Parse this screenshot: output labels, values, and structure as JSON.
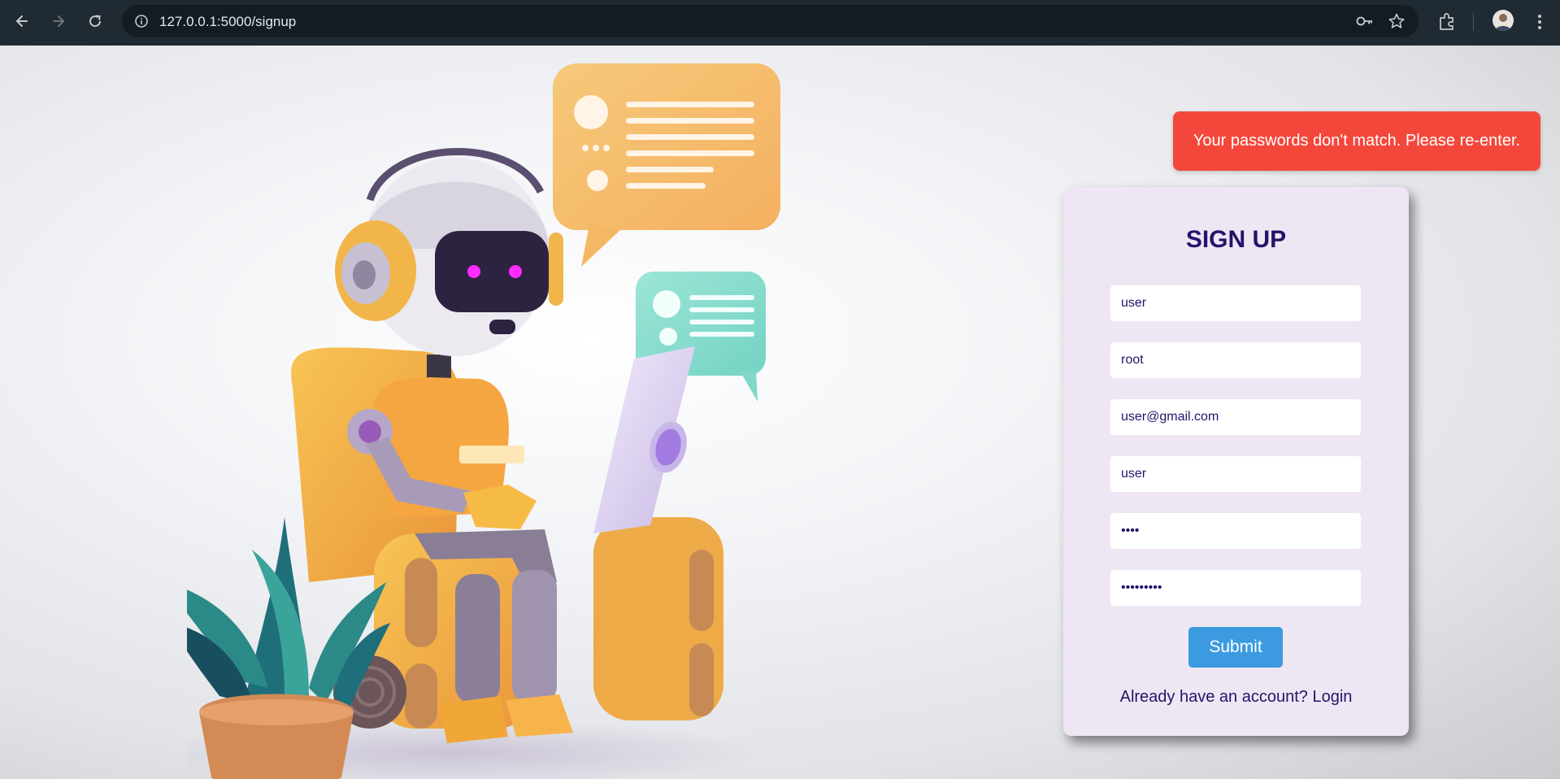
{
  "browser": {
    "url": "127.0.0.1:5000/signup",
    "icons": [
      "back-icon",
      "forward-icon",
      "reload-icon",
      "site-info-icon",
      "password-key-icon",
      "bookmark-star-icon",
      "extensions-icon",
      "profile-avatar",
      "more-menu-icon"
    ]
  },
  "alert": {
    "message": "Your passwords don't match. Please re-enter.",
    "color": "#f3473b"
  },
  "signup": {
    "title": "SIGN UP",
    "fields": [
      {
        "value": "user"
      },
      {
        "value": "root"
      },
      {
        "value": "user@gmail.com"
      },
      {
        "value": "user"
      },
      {
        "value": "1234"
      },
      {
        "value": "123456789"
      }
    ],
    "submit_label": "Submit",
    "footer_text": "Already have an account?",
    "login_link": "Login"
  },
  "colors": {
    "accent": "#3c9be0",
    "card_bg": "#efe6f4",
    "heading": "#23146a"
  }
}
